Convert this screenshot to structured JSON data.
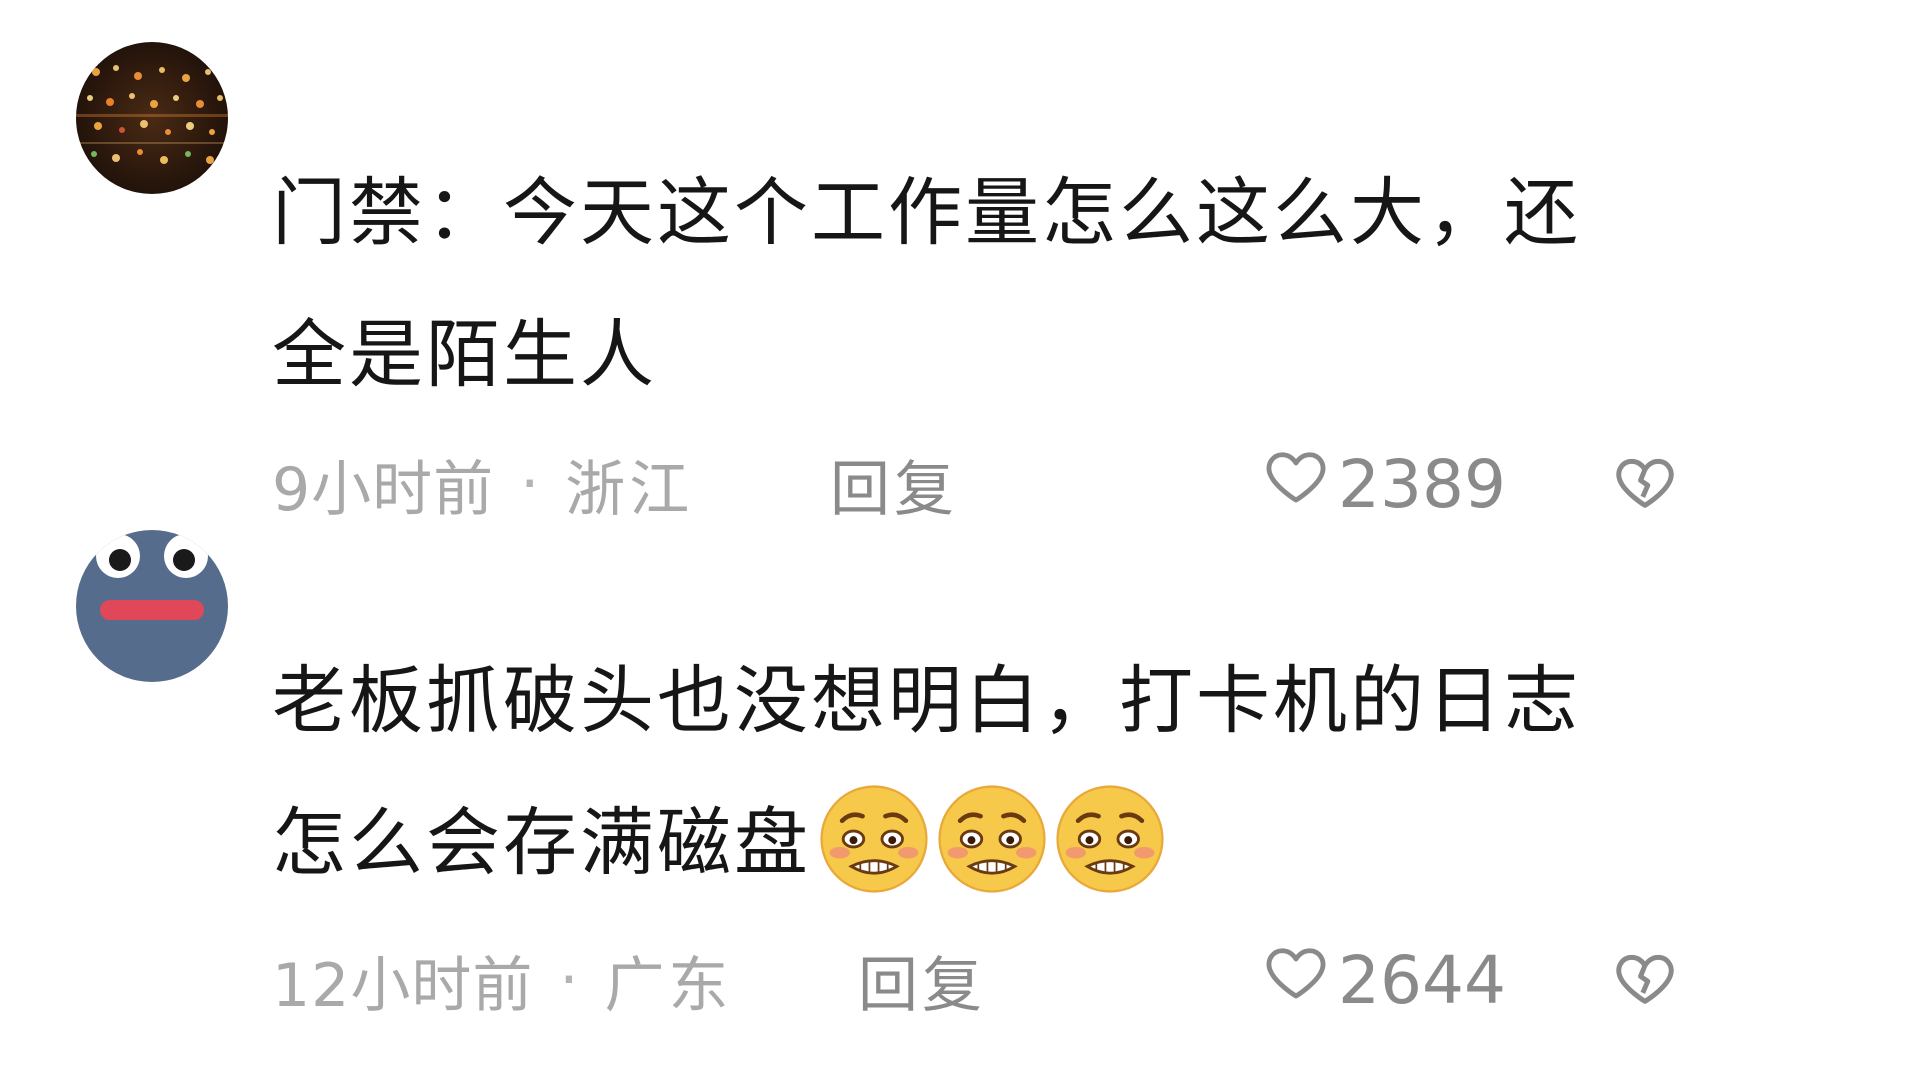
{
  "comments": [
    {
      "avatar": "bokeh-lights-avatar",
      "lines": [
        "门禁：今天这个工作量怎么这么大，还",
        "全是陌生人"
      ],
      "emojis": [],
      "time": "9小时前",
      "location": "浙江",
      "reply_label": "回复",
      "likes": "2389"
    },
    {
      "avatar": "cartoon-face-avatar",
      "lines": [
        "老板抓破头也没想明白，打卡机的日志",
        "怎么会存满磁盘"
      ],
      "emojis": [
        "pleading-face-emoji",
        "pleading-face-emoji",
        "pleading-face-emoji"
      ],
      "time": "12小时前",
      "location": "广东",
      "reply_label": "回复",
      "likes": "2644"
    }
  ],
  "separator": "·",
  "icons": {
    "like": "heart-outline-icon",
    "dislike": "broken-heart-icon"
  },
  "colors": {
    "text": "#161616",
    "meta": "#a9a9a9",
    "action": "#8a8a8a",
    "avatar2_bg": "#566c8c",
    "avatar2_mouth": "#e0485a",
    "emoji_yellow": "#f7c94a"
  }
}
